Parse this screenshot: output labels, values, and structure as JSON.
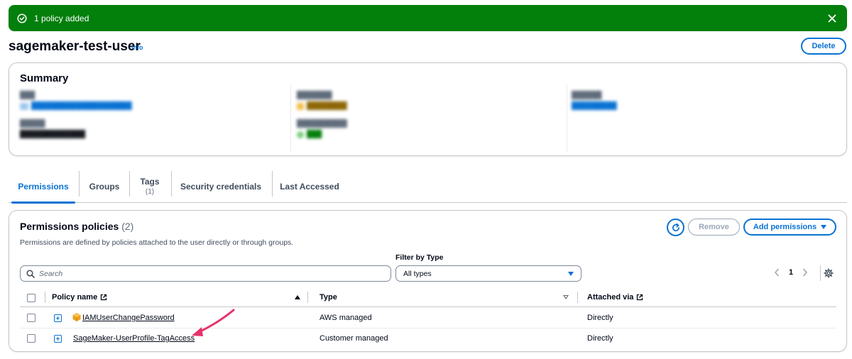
{
  "flash": {
    "message": "1 policy added",
    "status_icon": "check-circle-icon",
    "close_icon": "close-icon",
    "color": "#037f0c"
  },
  "header": {
    "title": "sagemaker-test-user",
    "info_label": "Info",
    "delete_label": "Delete"
  },
  "summary": {
    "heading": "Summary"
  },
  "tabs": [
    {
      "label": "Permissions",
      "count": ""
    },
    {
      "label": "Groups",
      "count": ""
    },
    {
      "label": "Tags",
      "count": "(1)"
    },
    {
      "label": "Security credentials",
      "count": ""
    },
    {
      "label": "Last Accessed",
      "count": ""
    }
  ],
  "permissions": {
    "title": "Permissions policies",
    "count": "(2)",
    "description": "Permissions are defined by policies attached to the user directly or through groups.",
    "refresh_icon": "refresh-icon",
    "remove_label": "Remove",
    "add_label": "Add permissions",
    "search_placeholder": "Search",
    "filter_label": "Filter by Type",
    "filter_value": "All types",
    "page_number": "1",
    "columns": {
      "policy_name": "Policy name",
      "type": "Type",
      "attached_via": "Attached via"
    },
    "rows": [
      {
        "policy_name": "IAMUserChangePassword",
        "type": "AWS managed",
        "attached_via": "Directly",
        "icon": "aws-managed-policy-icon"
      },
      {
        "policy_name": "SageMaker-UserProfile-TagAccess",
        "type": "Customer managed",
        "attached_via": "Directly",
        "icon": ""
      }
    ]
  },
  "colors": {
    "accent": "#0972d3",
    "success": "#037f0c",
    "annotation_arrow": "#e8336b"
  }
}
